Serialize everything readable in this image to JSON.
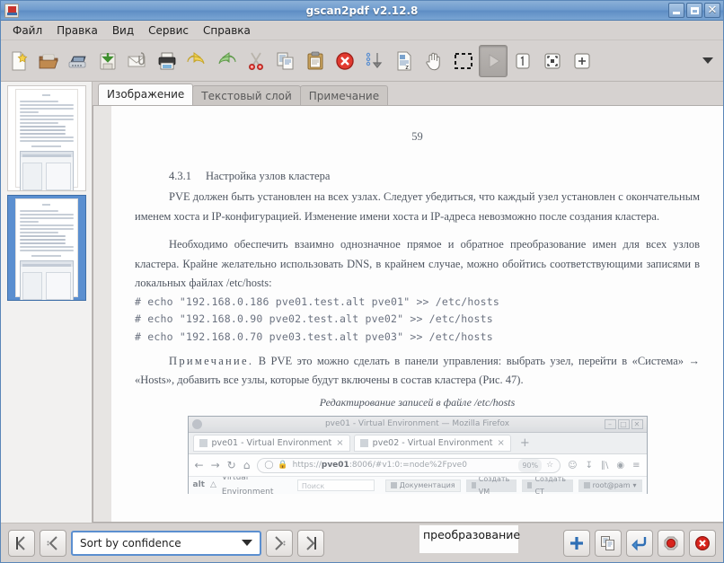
{
  "window": {
    "title": "gscan2pdf v2.12.8",
    "app_icon": "app-icon",
    "minimize": "–",
    "maximize": "□",
    "close": "✕"
  },
  "menubar": {
    "items": [
      {
        "label": "Файл",
        "name": "menu-file"
      },
      {
        "label": "Правка",
        "name": "menu-edit"
      },
      {
        "label": "Вид",
        "name": "menu-view"
      },
      {
        "label": "Сервис",
        "name": "menu-tools"
      },
      {
        "label": "Справка",
        "name": "menu-help"
      }
    ]
  },
  "toolbar": {
    "items": [
      {
        "icon": "new-document-icon"
      },
      {
        "icon": "open-folder-icon"
      },
      {
        "icon": "scanner-icon"
      },
      {
        "icon": "save-icon"
      },
      {
        "icon": "email-attachment-icon"
      },
      {
        "icon": "print-icon"
      },
      {
        "icon": "undo-icon"
      },
      {
        "icon": "redo-icon"
      },
      {
        "icon": "cut-scissors-icon"
      },
      {
        "icon": "copy-icon"
      },
      {
        "icon": "paste-icon"
      },
      {
        "icon": "delete-icon"
      },
      {
        "icon": "sort-descending-icon"
      },
      {
        "icon": "ocr-page-icon"
      },
      {
        "icon": "hand-pan-icon"
      },
      {
        "icon": "selection-rectangle-icon"
      },
      {
        "icon": "play-run-icon"
      },
      {
        "icon": "zoom-100-icon"
      },
      {
        "icon": "zoom-fit-icon"
      },
      {
        "icon": "zoom-in-icon"
      }
    ],
    "overflow_icon": "chevron-down-icon"
  },
  "sidebar": {
    "thumbnails": [
      {
        "name": "page-thumbnail-1",
        "selected": false
      },
      {
        "name": "page-thumbnail-2",
        "selected": true
      }
    ]
  },
  "tabs": [
    {
      "label": "Изображение",
      "name": "tab-image",
      "selected": true
    },
    {
      "label": "Текстовый слой",
      "name": "tab-text-layer",
      "selected": false
    },
    {
      "label": "Примечание",
      "name": "tab-annotation",
      "selected": false
    }
  ],
  "document": {
    "page_number": "59",
    "heading_number": "4.3.1",
    "heading_text": "Настройка узлов кластера",
    "para1": "PVE должен быть установлен на всех узлах. Следует убедиться, что каждый узел установлен с окончательным именем хоста и IP-конфигурацией. Изменение имени хоста и IP-адреса невозможно после создания кластера.",
    "para2": "Необходимо обеспечить взаимно однозначное прямое и обратное преобразование имен для всех узлов кластера. Крайне желательно использовать DNS, в крайнем случае, можно обойтись соответствующими записями в локальных файлах /etc/hosts:",
    "code_lines": [
      "# echo \"192.168.0.186 pve01.test.alt pve01\" >> /etc/hosts",
      "# echo \"192.168.0.90 pve02.test.alt pve02\" >> /etc/hosts",
      "# echo \"192.168.0.70 pve03.test.alt pve03\" >> /etc/hosts"
    ],
    "note_lead": "Примечание.",
    "note_text": " В PVE это можно сделать в панели управления: выбрать узел, перейти в «Система» → «Hosts», добавить все узлы, которые будут включены в состав кластера (Рис. 47).",
    "caption": "Редактирование записей в файле /etc/hosts",
    "embedded_screenshot": {
      "window_title": "pve01 - Virtual Environment — Mozilla Firefox",
      "tabs": [
        {
          "label": "pve01 - Virtual Environment",
          "close": "×"
        },
        {
          "label": "pve02 - Virtual Environment",
          "close": "×"
        }
      ],
      "new_tab": "+",
      "nav": {
        "back": "←",
        "forward": "→",
        "reload": "↻",
        "home": "⌂"
      },
      "url_prefix": "https://",
      "url_host": "pve01",
      "url_rest": ":8006/#v1:0:=node%2Fpve0",
      "zoom_level": "90%",
      "bookmark_icon": "star-icon",
      "app_logo": "alt",
      "app_brand": "Virtual Environment",
      "search_placeholder": "Поиск",
      "buttons": [
        "Документация",
        "Создать VM",
        "Создать CT",
        "root@pam"
      ]
    }
  },
  "bottombar": {
    "first_label": "first-page-button",
    "prev_label": "previous-page-button",
    "sort_value": "Sort by confidence",
    "next_label": "next-page-button",
    "last_label": "last-page-button",
    "ocr_text": "преобразование",
    "actions": [
      {
        "icon": "add-icon",
        "name": "add-word-button"
      },
      {
        "icon": "duplicate-icon",
        "name": "duplicate-word-button"
      },
      {
        "icon": "apply-enter-icon",
        "name": "apply-button"
      },
      {
        "icon": "record-stop-icon",
        "name": "delete-word-button"
      },
      {
        "icon": "cancel-icon",
        "name": "cancel-button"
      }
    ]
  },
  "colors": {
    "titlebar": "#6e9bcd",
    "accent": "#5b8fd0",
    "chrome": "#d6d2d0",
    "selection": "#5b8fd0"
  }
}
